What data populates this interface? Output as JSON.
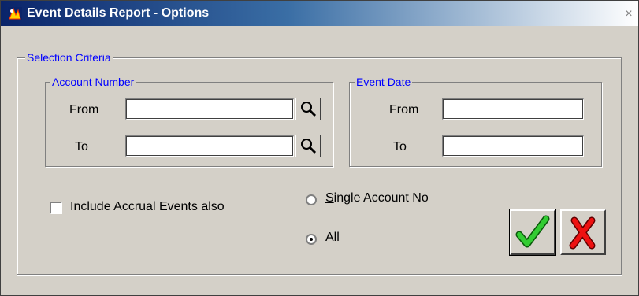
{
  "window": {
    "title": "Event Details Report - Options",
    "close_glyph": "×"
  },
  "selection_criteria": {
    "legend": "Selection Criteria"
  },
  "account_number": {
    "legend": "Account Number",
    "from_label": "From",
    "to_label": "To",
    "from_value": "",
    "to_value": ""
  },
  "event_date": {
    "legend": "Event Date",
    "from_label": "From",
    "to_label": "To",
    "from_value": "",
    "to_value": ""
  },
  "include_accrual": {
    "label": "Include Accrual Events also",
    "checked": false
  },
  "account_scope": {
    "options": [
      {
        "mnemonic": "S",
        "rest": "ingle Account No",
        "selected": false
      },
      {
        "mnemonic": "A",
        "rest": "ll",
        "selected": true
      }
    ]
  },
  "buttons": {
    "ok_icon": "green-check-icon",
    "cancel_icon": "red-x-icon"
  },
  "colors": {
    "legend_text": "#0000ff",
    "title_bar": "#0a246a",
    "ok_check": "#22aa22",
    "cancel_x": "#e00000"
  }
}
